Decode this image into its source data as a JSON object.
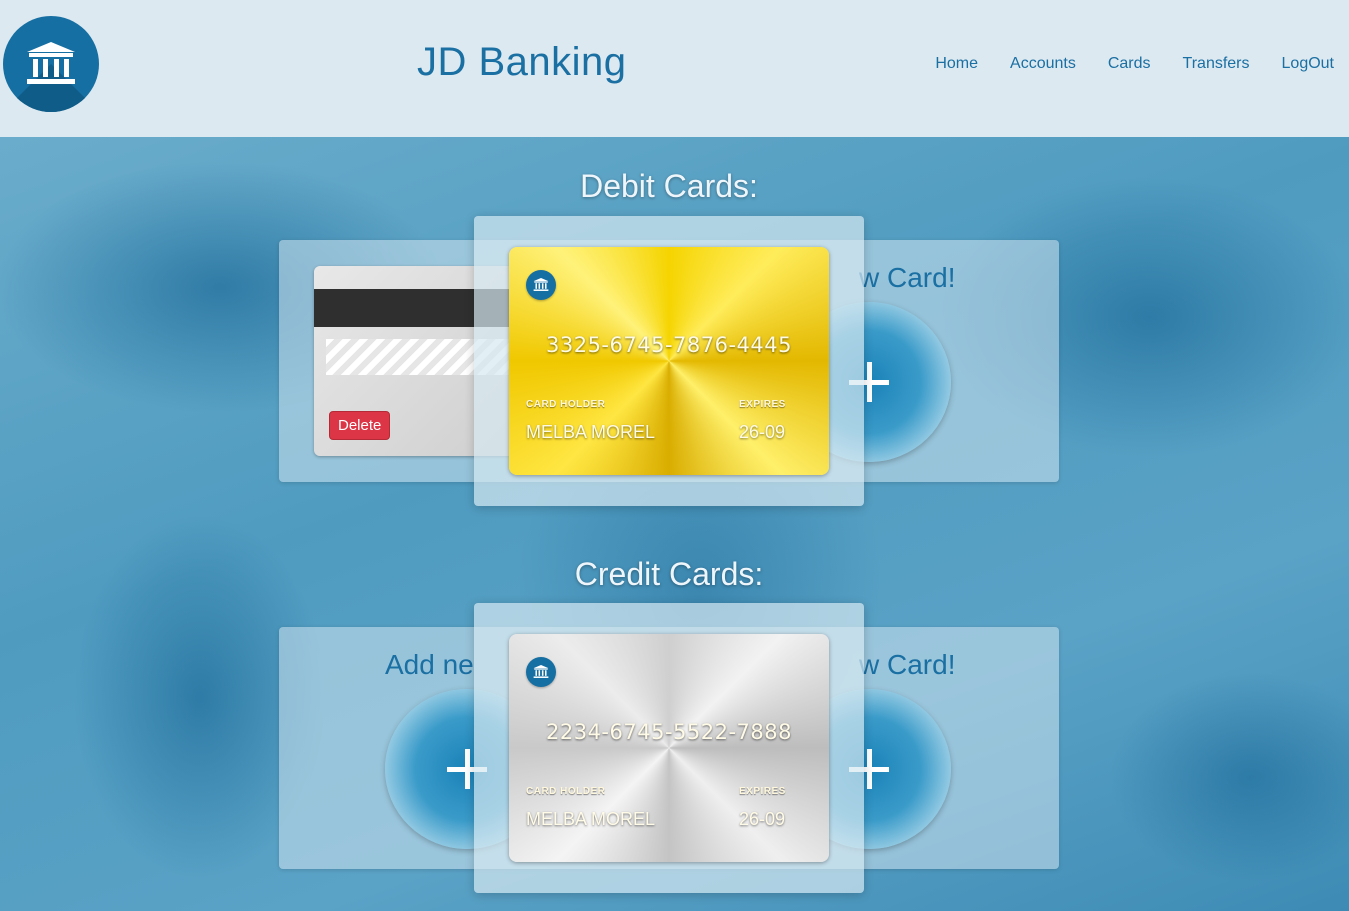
{
  "header": {
    "brand": "JD Banking",
    "logo_icon": "bank-building-icon",
    "nav": [
      "Home",
      "Accounts",
      "Cards",
      "Transfers",
      "LogOut"
    ]
  },
  "debit": {
    "title": "Debit Cards:",
    "add_text_right": "w Card!",
    "delete_label": "Delete",
    "card": {
      "number": "3325-6745-7876-4445",
      "holder_label": "CARD HOLDER",
      "holder": "MELBA MOREL",
      "expires_label": "EXPIRES",
      "expires": "26-09",
      "color": "#f5d400"
    }
  },
  "credit": {
    "title": "Credit Cards:",
    "add_text_left": "Add ne",
    "add_text_right": "w Card!",
    "card": {
      "number": "2234-6745-5522-7888",
      "holder_label": "CARD HOLDER",
      "holder": "MELBA MOREL",
      "expires_label": "EXPIRES",
      "expires": "26-09",
      "color": "#d0d0d0"
    }
  },
  "colors": {
    "accent": "#1a6fa3",
    "header_bg": "#dde9f0",
    "delete": "#dc3545"
  }
}
